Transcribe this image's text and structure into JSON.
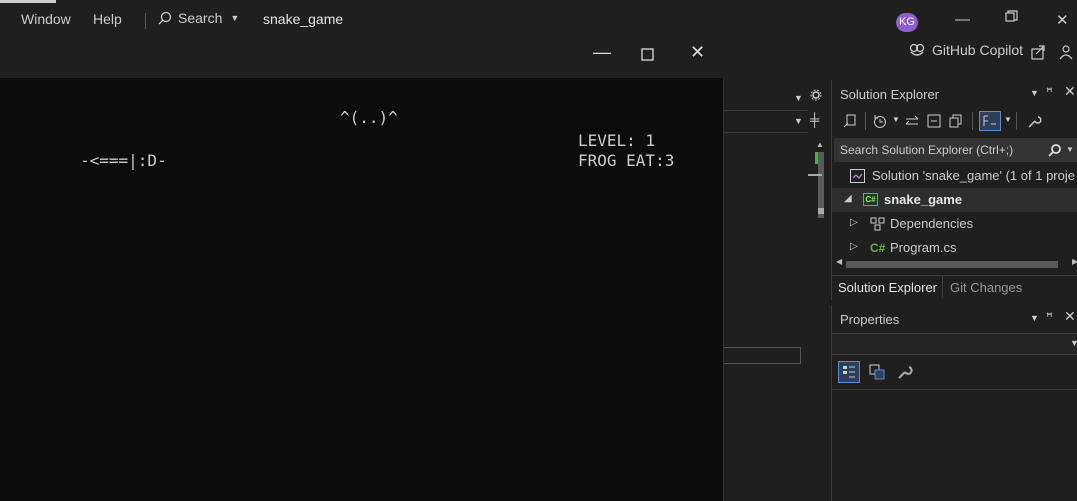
{
  "menubar": {
    "window_label": "Window",
    "help_label": "Help",
    "search_label": "Search",
    "project_title": "snake_game",
    "avatar_initials": "KG"
  },
  "copilot": {
    "label": "GitHub Copilot"
  },
  "console": {
    "frog": "^(..)^",
    "snake": "-<===|:D-",
    "level": "LEVEL: 1",
    "frog_eat": "FROG EAT:3"
  },
  "solution_explorer": {
    "title": "Solution Explorer",
    "search_placeholder": "Search Solution Explorer (Ctrl+;)",
    "tree": {
      "solution": "Solution 'snake_game' (1 of 1 proje",
      "project": "snake_game",
      "dependencies": "Dependencies",
      "program": "Program.cs"
    },
    "tabs": {
      "solution_explorer": "Solution Explorer",
      "git_changes": "Git Changes"
    }
  },
  "properties": {
    "title": "Properties"
  },
  "colors": {
    "accent": "#8e5ccf",
    "csharp": "#68217a",
    "console_bg": "#0c0c0c",
    "chrome": "#1f1f1f"
  }
}
